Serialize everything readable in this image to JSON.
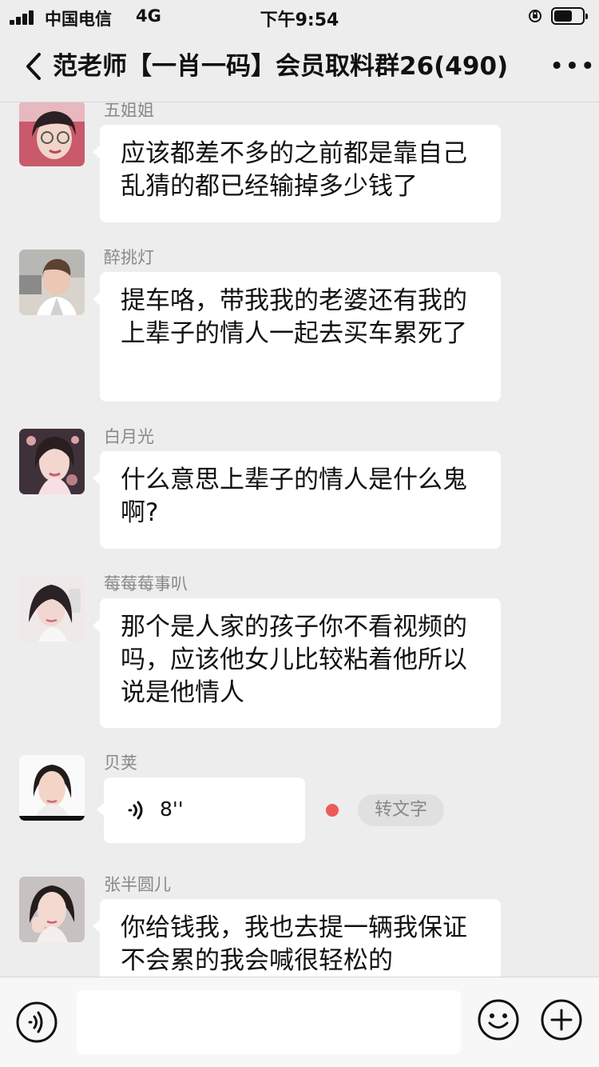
{
  "status_bar": {
    "carrier": "中国电信",
    "network": "4G",
    "time": "下午9:54",
    "battery_level": 0.6
  },
  "nav": {
    "title": "范老师【一肖一码】会员取料群26(490)",
    "more_icon": "more-dots-icon",
    "back_icon": "back-chevron-icon"
  },
  "messages": [
    {
      "sender": "五姐姐",
      "text": "应该都差不多的之前都是靠自己乱猜的都已经输掉多少钱了"
    },
    {
      "sender": "醉挑灯",
      "text": "提车咯，带我我的老婆还有我的上辈子的情人一起去买车累死了"
    },
    {
      "sender": "白月光",
      "text": "什么意思上辈子的情人是什么鬼啊?"
    },
    {
      "sender": "莓莓莓事叭",
      "text": "那个是人家的孩子你不看视频的吗，应该他女儿比较粘着他所以说是他情人"
    },
    {
      "sender": "贝荚",
      "voice_duration": "8''",
      "convert_label": "转文字"
    },
    {
      "sender": "张半圆儿",
      "text": "你给钱我，我也去提一辆我保证不会累的我会喊很轻松的"
    }
  ],
  "bottom_bar": {
    "voice_icon": "voice-input-icon",
    "emoji_icon": "emoji-icon",
    "plus_icon": "plus-icon",
    "input_value": ""
  },
  "colors": {
    "background": "#ededed",
    "bubble": "#ffffff",
    "unread_dot": "#ee5a5a"
  }
}
